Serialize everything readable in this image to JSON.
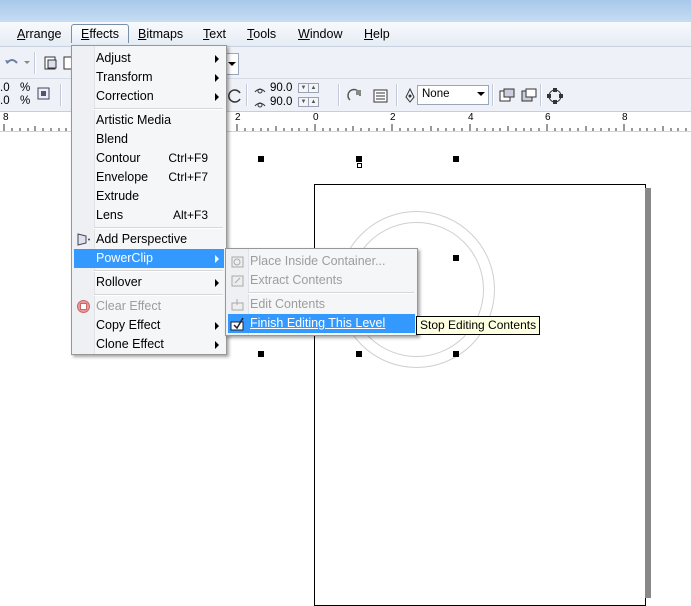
{
  "menubar": {
    "items": [
      {
        "label": "Arrange",
        "key": "A",
        "rest": "rrange"
      },
      {
        "label": "Effects",
        "key": "E",
        "rest": "ffects"
      },
      {
        "label": "Bitmaps",
        "key": "B",
        "rest": "itmaps"
      },
      {
        "label": "Text",
        "key": "T",
        "rest": "ext"
      },
      {
        "label": "Tools",
        "key": "T",
        "rest": "ools"
      },
      {
        "label": "Window",
        "key": "W",
        "rest": "indow"
      },
      {
        "label": "Help",
        "key": "H",
        "rest": "elp"
      }
    ]
  },
  "toolbar": {
    "left_values": [
      ".0",
      ".0"
    ],
    "left_units": [
      "%",
      "%"
    ],
    "rotation_1": "90.0",
    "rotation_2": "90.0",
    "outline_select": "None"
  },
  "ruler": {
    "labels": [
      "8",
      "2",
      "0",
      "2",
      "4",
      "6",
      "8"
    ]
  },
  "effects_menu": {
    "items": [
      {
        "label": "Adjust",
        "submenu": true
      },
      {
        "label": "Transform",
        "submenu": true
      },
      {
        "label": "Correction",
        "submenu": true
      },
      {
        "label": "Artistic Media"
      },
      {
        "label": "Blend"
      },
      {
        "label": "Contour",
        "shortcut": "Ctrl+F9"
      },
      {
        "label": "Envelope",
        "shortcut": "Ctrl+F7"
      },
      {
        "label": "Extrude"
      },
      {
        "label": "Lens",
        "shortcut": "Alt+F3"
      },
      {
        "label": "Add Perspective"
      },
      {
        "label": "PowerClip",
        "submenu": true
      },
      {
        "label": "Rollover",
        "submenu": true
      },
      {
        "label": "Clear Effect"
      },
      {
        "label": "Copy Effect",
        "submenu": true
      },
      {
        "label": "Clone Effect",
        "submenu": true
      }
    ]
  },
  "powerclip_menu": {
    "items": [
      {
        "label": "Place Inside Container..."
      },
      {
        "label": "Extract Contents"
      },
      {
        "label": "Edit Contents"
      },
      {
        "label": "Finish Editing This Level"
      }
    ]
  },
  "tooltip": {
    "text": "Stop Editing Contents"
  },
  "colors": {
    "highlight": "#3399ff",
    "menu_bg": "#f5f6f7",
    "tooltip_bg": "#ffffe1"
  }
}
